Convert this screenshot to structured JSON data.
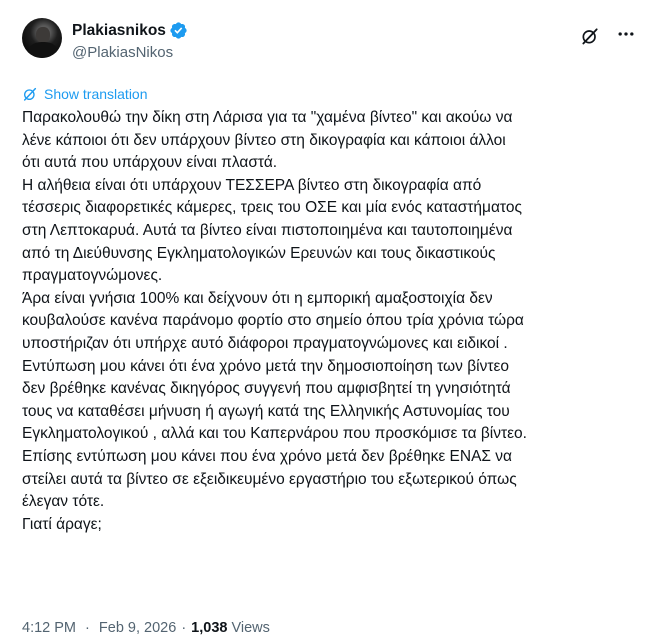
{
  "author": {
    "display_name": "Plakiasnikos",
    "handle": "@PlakiasNikos",
    "verified": true
  },
  "actions": {
    "grok_icon": "grok-icon",
    "more_icon": "more-icon"
  },
  "translation": {
    "label": "Show translation",
    "icon": "translate-icon"
  },
  "tweet": {
    "lines": [
      "Παρακολουθώ την δίκη στη Λάρισα για τα \"χαμένα βίντεο\" και ακούω να",
      "λένε κάποιοι ότι δεν υπάρχουν βίντεο στη δικογραφία και κάποιοι άλλοι",
      "ότι αυτά που υπάρχουν είναι πλαστά.",
      "Η αλήθεια είναι ότι υπάρχουν ΤΕΣΣΕΡΑ βίντεο στη δικογραφία από",
      "τέσσερις διαφορετικές κάμερες, τρεις του ΟΣΕ και μία ενός καταστήματος",
      "στη Λεπτοκαρυά. Αυτά τα βίντεο είναι πιστοποιημένα και ταυτοποιημένα",
      "από τη Διεύθυνσης Εγκληματολογικών Ερευνών και τους δικαστικούς",
      "πραγματογνώμονες.",
      "Άρα είναι γνήσια 100% και δείχνουν ότι η εμπορική αμαξοστοιχία δεν",
      "κουβαλούσε κανένα παράνομο φορτίο στο σημείο όπου τρία χρόνια τώρα",
      "υποστήριζαν ότι υπήρχε αυτό διάφοροι πραγματογνώμονες και ειδικοί .",
      "Εντύπωση μου κάνει ότι ένα χρόνο μετά την δημοσιοποίηση των βίντεο",
      "δεν βρέθηκε κανένας δικηγόρος συγγενή που αμφισβητεί τη γνησιότητά",
      "τους να καταθέσει μήνυση ή αγωγή κατά της Ελληνικής Αστυνομίας του",
      "Εγκληματολογικού , αλλά και του Καπερνάρου που προσκόμισε τα βίντεο.",
      "Επίσης εντύπωση μου κάνει που ένα χρόνο μετά δεν βρέθηκε ΕΝΑΣ να",
      "στείλει αυτά τα βίντεο σε εξειδικευμένο εργαστήριο του εξωτερικού όπως",
      "έλεγαν τότε.",
      "Γιατί άραγε;"
    ]
  },
  "meta": {
    "time": "4:12 PM",
    "separator": "·",
    "date": "Feb 9, 2026",
    "views_count": "1,038",
    "views_label": "Views"
  },
  "colors": {
    "link": "#1d9bf0",
    "text": "#0f1419",
    "secondary": "#536471",
    "verified": "#1d9bf0"
  }
}
